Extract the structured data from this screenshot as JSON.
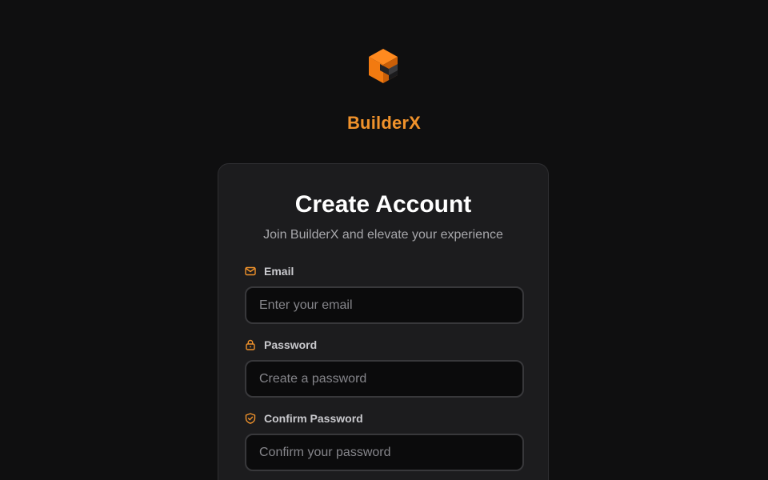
{
  "brand": {
    "logo_icon": "builderx-logo-icon",
    "name": "BuilderX",
    "accent_color": "#f0922b"
  },
  "form": {
    "title": "Create Account",
    "subtitle": "Join BuilderX and elevate your experience",
    "fields": [
      {
        "icon": "mail-icon",
        "label": "Email",
        "placeholder": "Enter your email",
        "value": ""
      },
      {
        "icon": "lock-icon",
        "label": "Password",
        "placeholder": "Create a password",
        "value": ""
      },
      {
        "icon": "shield-check-icon",
        "label": "Confirm Password",
        "placeholder": "Confirm your password",
        "value": ""
      }
    ]
  }
}
